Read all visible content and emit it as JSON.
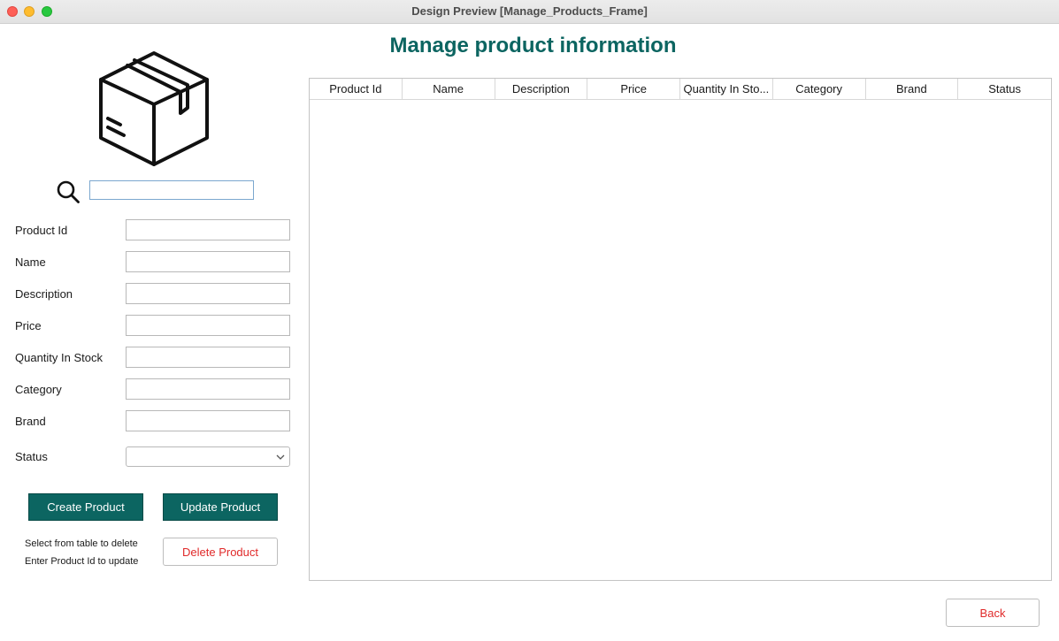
{
  "window": {
    "title": "Design Preview [Manage_Products_Frame]"
  },
  "page": {
    "title": "Manage product information"
  },
  "search": {
    "value": "",
    "placeholder": ""
  },
  "form": {
    "fields": [
      {
        "label": "Product Id",
        "value": ""
      },
      {
        "label": "Name",
        "value": ""
      },
      {
        "label": "Description",
        "value": ""
      },
      {
        "label": "Price",
        "value": ""
      },
      {
        "label": "Quantity In Stock",
        "value": ""
      },
      {
        "label": "Category",
        "value": ""
      },
      {
        "label": "Brand",
        "value": ""
      }
    ],
    "status": {
      "label": "Status",
      "selected": ""
    }
  },
  "buttons": {
    "create": "Create Product",
    "update": "Update Product",
    "delete": "Delete Product",
    "back": "Back"
  },
  "hints": {
    "delete": "Select from table to delete",
    "update": "Enter Product Id to update"
  },
  "table": {
    "columns": [
      "Product Id",
      "Name",
      "Description",
      "Price",
      "Quantity In Sto...",
      "Category",
      "Brand",
      "Status"
    ],
    "rows": []
  },
  "icons": {
    "product": "package-box-icon",
    "search": "search-icon",
    "dropdown": "chevron-down-icon"
  },
  "colors": {
    "accent": "#0c6561",
    "danger": "#e02a2a",
    "search_border": "#7ba7cf"
  }
}
